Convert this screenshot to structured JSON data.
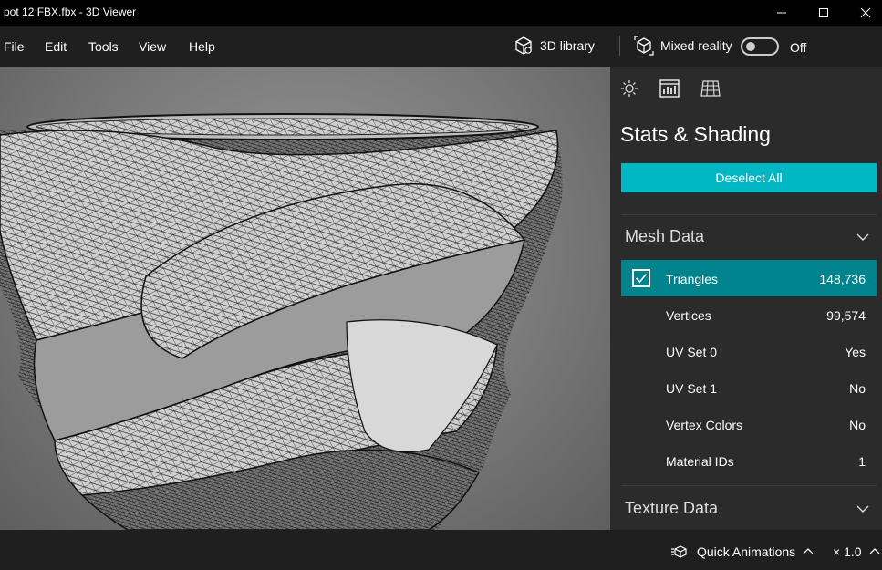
{
  "window": {
    "title": "pot 12 FBX.fbx - 3D Viewer",
    "minimize_icon": "minimize-icon",
    "maximize_icon": "maximize-icon",
    "close_icon": "close-icon"
  },
  "menu": {
    "items": [
      {
        "label": "File"
      },
      {
        "label": "Edit"
      },
      {
        "label": "Tools"
      },
      {
        "label": "View"
      },
      {
        "label": "Help"
      }
    ],
    "library_label": "3D library",
    "mixed_reality_label": "Mixed reality",
    "toggle_state": "Off"
  },
  "panel": {
    "title": "Stats & Shading",
    "accent_color": "#00b7c3",
    "selected_row_color": "#00838d",
    "deselect_label": "Deselect All",
    "mesh_section": "Mesh Data",
    "mesh_rows": [
      {
        "label": "Triangles",
        "value": "148,736",
        "checked": true
      },
      {
        "label": "Vertices",
        "value": "99,574"
      },
      {
        "label": "UV Set 0",
        "value": "Yes"
      },
      {
        "label": "UV Set 1",
        "value": "No"
      },
      {
        "label": "Vertex Colors",
        "value": "No"
      },
      {
        "label": "Material IDs",
        "value": "1"
      }
    ],
    "texture_section": "Texture Data"
  },
  "status": {
    "animations_label": "Quick Animations",
    "speed": "× 1.0"
  }
}
